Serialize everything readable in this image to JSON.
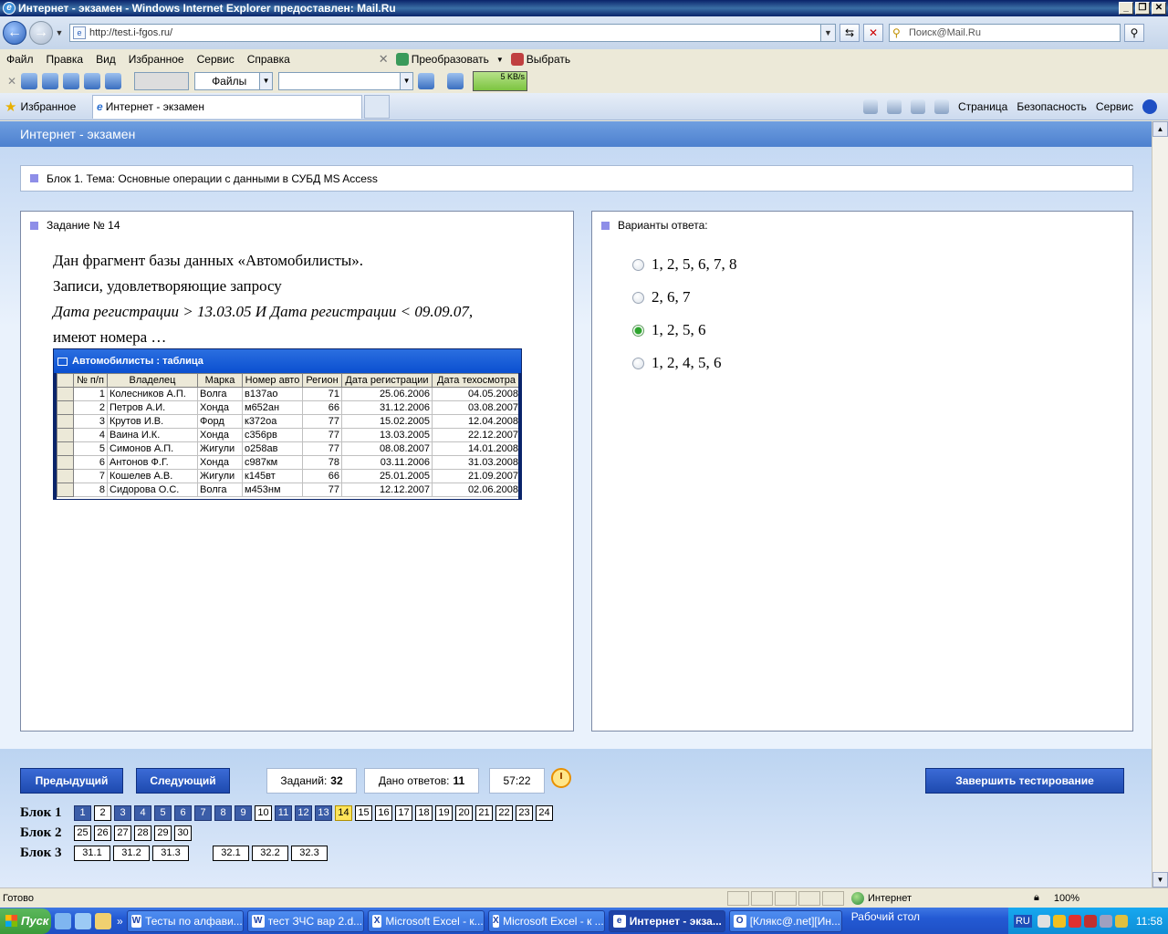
{
  "window": {
    "title": "Интернет - экзамен - Windows Internet Explorer предоставлен: Mail.Ru"
  },
  "address": {
    "url": "http://test.i-fgos.ru/",
    "search_placeholder": "Поиск@Mail.Ru"
  },
  "menu": {
    "items": [
      "Файл",
      "Правка",
      "Вид",
      "Избранное",
      "Сервис",
      "Справка"
    ],
    "convert": "Преобразовать",
    "select": "Выбрать"
  },
  "toolbar": {
    "files_label": "Файлы",
    "speed": "5 KB/s"
  },
  "tabs": {
    "favorites": "Избранное",
    "active_tab": "Интернет - экзамен",
    "page_menu": "Страница",
    "safety_menu": "Безопасность",
    "tools_menu": "Сервис"
  },
  "page": {
    "header": "Интернет - экзамен",
    "block_title": "Блок 1. Тема: Основные операции с данными в СУБД MS Access",
    "task_title": "Задание № 14",
    "question": {
      "line1": "Дан фрагмент базы данных «Автомобилисты».",
      "line2": "Записи, удовлетворяющие запросу",
      "line3": "Дата регистрации > 13.03.05 И Дата регистрации < 09.09.07,",
      "line4": "имеют номера …"
    },
    "table": {
      "title": "Автомобилисты : таблица",
      "columns": [
        "№ п/п",
        "Владелец",
        "Марка",
        "Номер авто",
        "Регион",
        "Дата регистрации",
        "Дата техосмотра"
      ],
      "rows": [
        [
          "1",
          "Колесников А.П.",
          "Волга",
          "в137ао",
          "71",
          "25.06.2006",
          "04.05.2008"
        ],
        [
          "2",
          "Петров А.И.",
          "Хонда",
          "м652ан",
          "66",
          "31.12.2006",
          "03.08.2007"
        ],
        [
          "3",
          "Крутов И.В.",
          "Форд",
          "к372оа",
          "77",
          "15.02.2005",
          "12.04.2008"
        ],
        [
          "4",
          "Ваина И.К.",
          "Хонда",
          "с356рв",
          "77",
          "13.03.2005",
          "22.12.2007"
        ],
        [
          "5",
          "Симонов А.П.",
          "Жигули",
          "о258ав",
          "77",
          "08.08.2007",
          "14.01.2008"
        ],
        [
          "6",
          "Антонов Ф.Г.",
          "Хонда",
          "с987км",
          "78",
          "03.11.2006",
          "31.03.2008"
        ],
        [
          "7",
          "Кошелев А.В.",
          "Жигули",
          "к145вт",
          "66",
          "25.01.2005",
          "21.09.2007"
        ],
        [
          "8",
          "Сидорова О.С.",
          "Волга",
          "м453нм",
          "77",
          "12.12.2007",
          "02.06.2008"
        ]
      ]
    },
    "answers_title": "Варианты ответа:",
    "answers": [
      {
        "label": "1, 2, 5, 6, 7, 8",
        "checked": false
      },
      {
        "label": "2, 6, 7",
        "checked": false
      },
      {
        "label": "1, 2, 5, 6",
        "checked": true
      },
      {
        "label": "1, 2, 4, 5, 6",
        "checked": false
      }
    ]
  },
  "footer": {
    "prev_label": "Предыдущий",
    "next_label": "Следующий",
    "tasks_label": "Заданий:",
    "tasks_count": "32",
    "answered_label": "Дано ответов:",
    "answered_count": "11",
    "timer": "57:22",
    "finish_label": "Завершить тестирование",
    "blocks": [
      {
        "label": "Блок 1",
        "items": [
          "1",
          "2",
          "3",
          "4",
          "5",
          "6",
          "7",
          "8",
          "9",
          "10",
          "11",
          "12",
          "13",
          "14",
          "15",
          "16",
          "17",
          "18",
          "19",
          "20",
          "21",
          "22",
          "23",
          "24"
        ]
      },
      {
        "label": "Блок 2",
        "items": [
          "25",
          "26",
          "27",
          "28",
          "29",
          "30"
        ]
      },
      {
        "label": "Блок 3",
        "items": [
          "31.1",
          "31.2",
          "31.3",
          "32.1",
          "32.2",
          "32.3"
        ]
      }
    ],
    "done_items": [
      "1",
      "3",
      "4",
      "5",
      "6",
      "7",
      "8",
      "9",
      "11",
      "12",
      "13"
    ],
    "current_item": "14"
  },
  "status": {
    "text": "Готово",
    "zone": "Интернет",
    "zoom": "100%"
  },
  "taskbar": {
    "start": "Пуск",
    "tasks": [
      {
        "glyph": "W",
        "label": "Тесты по алфави..."
      },
      {
        "glyph": "W",
        "label": "тест ЗЧС вар 2.d..."
      },
      {
        "glyph": "X",
        "label": "Microsoft Excel - к..."
      },
      {
        "glyph": "X",
        "label": "Microsoft Excel - к ..."
      },
      {
        "glyph": "e",
        "label": "Интернет - экза..."
      },
      {
        "glyph": "O",
        "label": "[Клякс@.net][Ин..."
      }
    ],
    "active_task": 4,
    "desktop": "Рабочий стол",
    "lang": "RU",
    "clock": "11:58"
  }
}
